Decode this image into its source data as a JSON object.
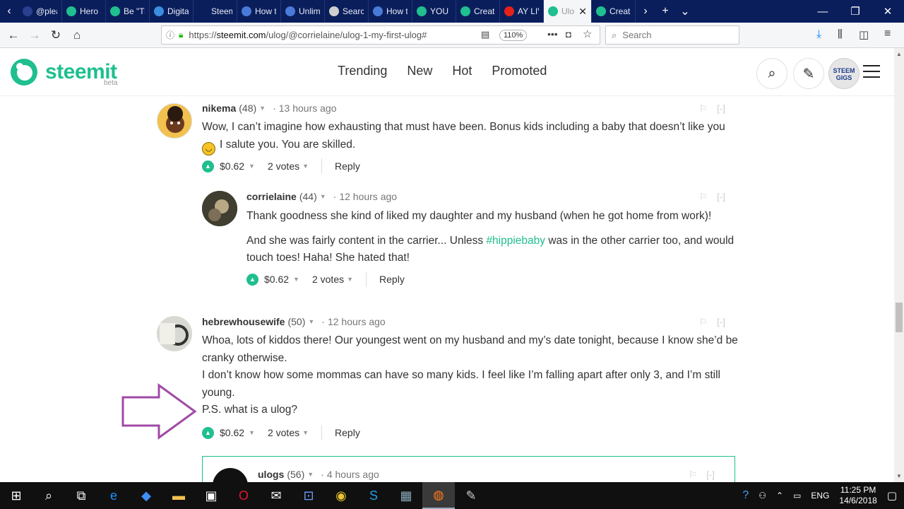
{
  "browser": {
    "tabs": [
      {
        "label": "@plea",
        "color": "#2a3f8f"
      },
      {
        "label": "Hero &",
        "color": "#1fbf8f"
      },
      {
        "label": "Be \"Tr",
        "color": "#1fbf8f"
      },
      {
        "label": "Digital",
        "color": "#3b8de0"
      },
      {
        "label": "Steem",
        "color": "#0a1e5c"
      },
      {
        "label": "How t",
        "color": "#4a7ad8"
      },
      {
        "label": "Unlim",
        "color": "#4a7ad8"
      },
      {
        "label": "Search",
        "color": "#cfcfcf"
      },
      {
        "label": "How t",
        "color": "#4a7ad8"
      },
      {
        "label": "YOU (",
        "color": "#1fbf8f"
      },
      {
        "label": "Create",
        "color": "#1fbf8f"
      },
      {
        "label": "AY LIV",
        "color": "#e62117"
      },
      {
        "label": "Ulo",
        "color": "#1fbf8f"
      },
      {
        "label": "Create",
        "color": "#1fbf8f"
      }
    ],
    "active_tab_index": 12,
    "url_prefix": "https://",
    "url_host": "steemit.com",
    "url_path": "/ulog/@corrielaine/ulog-1-my-first-ulog#",
    "zoom": "110%",
    "search_placeholder": "Search"
  },
  "site": {
    "logo_text": "steemit",
    "beta": "beta",
    "nav": [
      "Trending",
      "New",
      "Hot",
      "Promoted"
    ],
    "avatar_text_1": "STEEM",
    "avatar_text_2": "GIGS"
  },
  "comments": [
    {
      "author": "nikema",
      "rep": "(48)",
      "time": "13 hours ago",
      "flag": "[-]",
      "paragraphs": [
        "Wow, I can’t imagine how exhausting that must have been. Bonus kids including a baby that doesn’t like you",
        "I salute you. You are skilled."
      ],
      "payout": "$0.62",
      "votes": "2 votes",
      "reply": "Reply"
    },
    {
      "author": "corrielaine",
      "rep": "(44)",
      "time": "12 hours ago",
      "flag": "[-]",
      "p1": "Thank goodness she kind of liked my daughter and my husband (when he got home from work)!",
      "p2_before": "And she was fairly content in the carrier... Unless ",
      "p2_link": "#hippiebaby",
      "p2_after": " was in the other carrier too, and would touch toes! Haha! She hated that!",
      "payout": "$0.62",
      "votes": "2 votes",
      "reply": "Reply"
    },
    {
      "author": "hebrewhousewife",
      "rep": "(50)",
      "time": "12 hours ago",
      "flag": "[-]",
      "lines": [
        "Whoa, lots of kiddos there! Our youngest went on my husband and my’s date tonight, because I know she’d be cranky otherwise.",
        "I don’t know how some mommas can have so many kids. I feel like I’m falling apart after only 3, and I’m still young.",
        "P.S. what is a ulog?"
      ],
      "payout": "$0.62",
      "votes": "2 votes",
      "reply": "Reply"
    },
    {
      "author": "ulogs",
      "rep": "(56)",
      "time": "4 hours ago",
      "flag": "[-]"
    }
  ],
  "taskbar": {
    "language": "ENG",
    "time": "11:25 PM",
    "date": "14/6/2018"
  }
}
